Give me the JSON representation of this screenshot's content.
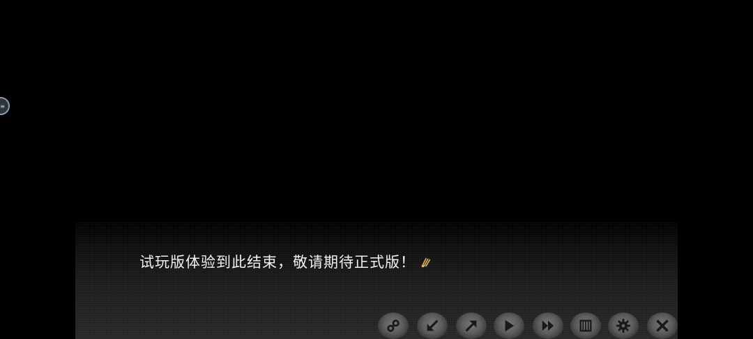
{
  "dialogue": {
    "text": "试玩版体验到此结束，敬请期待正式版！"
  },
  "toolbar": {
    "buttons": [
      {
        "name": "link-button",
        "icon": "link-icon"
      },
      {
        "name": "back-button",
        "icon": "arrow-down-left-icon"
      },
      {
        "name": "forward-button",
        "icon": "arrow-up-right-icon"
      },
      {
        "name": "auto-play-button",
        "icon": "play-icon"
      },
      {
        "name": "skip-button",
        "icon": "fast-forward-icon"
      },
      {
        "name": "log-button",
        "icon": "log-icon"
      },
      {
        "name": "settings-button",
        "icon": "gear-icon"
      },
      {
        "name": "close-button",
        "icon": "close-icon"
      }
    ]
  },
  "colors": {
    "background": "#000000",
    "text": "#f2f2f2",
    "button": "#5e5b5b",
    "button_icon": "#1a1919",
    "cursor": "#d9b46a"
  }
}
